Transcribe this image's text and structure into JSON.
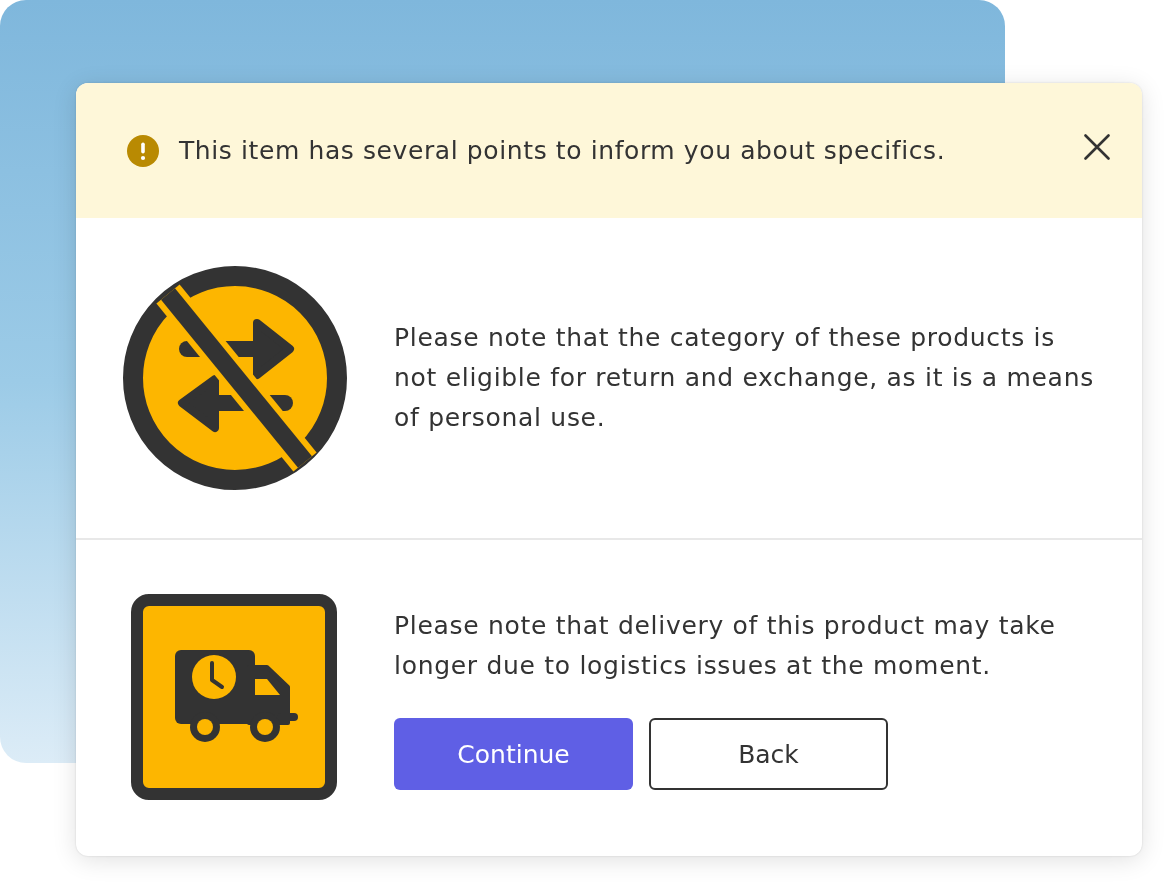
{
  "banner": {
    "text": "This item has several points to inform you about specifics."
  },
  "notices": [
    {
      "kind": "no-return",
      "text": "Please note that the category of these products is not eligible for return and exchange, as it is a means of personal use."
    },
    {
      "kind": "delayed-delivery",
      "text": "Please note that delivery of this product may take longer due to logistics issues at the moment."
    }
  ],
  "buttons": [
    {
      "label": "Continue",
      "kind": "primary"
    },
    {
      "label": "Back",
      "kind": "secondary"
    }
  ]
}
